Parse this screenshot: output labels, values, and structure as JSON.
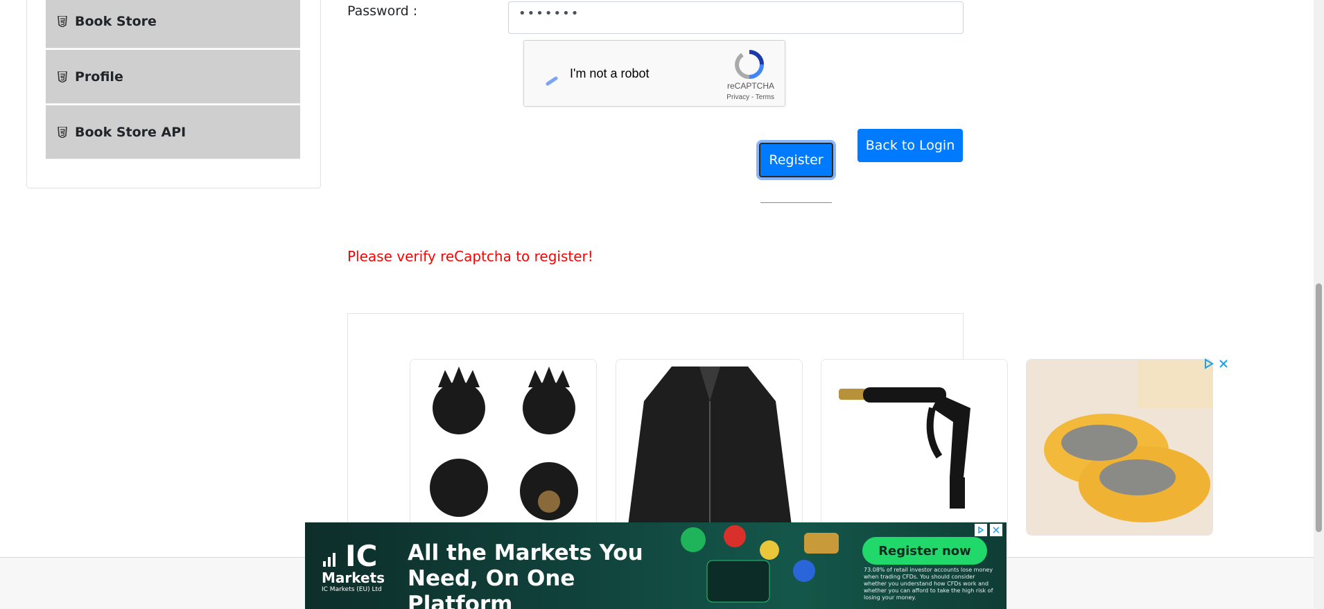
{
  "sidebar": {
    "items": [
      {
        "label": "Book Store",
        "icon": "html5-icon"
      },
      {
        "label": "Profile",
        "icon": "html5-icon"
      },
      {
        "label": "Book Store API",
        "icon": "html5-icon"
      }
    ]
  },
  "form": {
    "password_label": "Password :",
    "password_value": "•••••••"
  },
  "captcha": {
    "label": "I'm not a robot",
    "brand": "reCAPTCHA",
    "links": "Privacy - Terms"
  },
  "buttons": {
    "register": "Register",
    "back_to_login": "Back to Login"
  },
  "error": {
    "message": "Please verify reCaptcha to register!",
    "color": "#ff0000"
  },
  "ads": {
    "products": [
      {
        "name": "black crown valve caps",
        "icon": "product-image-icon"
      },
      {
        "name": "black leather jacket",
        "icon": "product-image-icon"
      },
      {
        "name": "black spray nozzle",
        "icon": "product-image-icon"
      },
      {
        "name": "yellow slippers",
        "icon": "product-image-icon"
      }
    ],
    "banner": {
      "brand_top": "IC",
      "brand_bottom": "Markets",
      "brand_sub": "IC Markets (EU) Ltd",
      "headline": "All the Markets You Need, On One Platform",
      "cta": "Register now",
      "disclaimer": "73.08% of retail investor accounts lose money when trading CFDs. You should consider whether you understand how CFDs work and whether you can afford to take the high risk of losing your money."
    }
  },
  "colors": {
    "primary": "#007bff",
    "sidebar_bg": "#cfcfcf",
    "banner_cta": "#21d96b"
  }
}
